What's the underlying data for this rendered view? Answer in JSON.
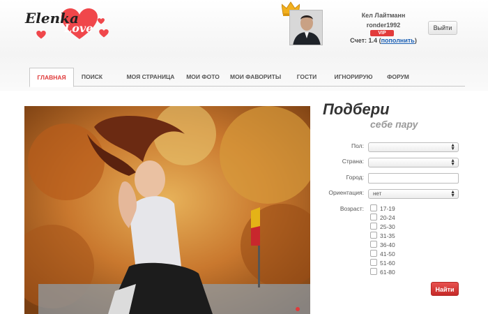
{
  "logo": {
    "line1": "Elenka",
    "line2": "Love"
  },
  "user": {
    "name": "Кел Лайтманн",
    "login": "ronder1992",
    "badge": "VIP",
    "account_label": "Счет: 1.4",
    "topup_link": "пополнить",
    "logout": "Выйти"
  },
  "nav": {
    "tabs": [
      {
        "label": "ГЛАВНАЯ",
        "active": true
      },
      {
        "label": "ПОИСК"
      },
      {
        "label": "МОЯ СТРАНИЦА"
      },
      {
        "label": "МОИ ФОТО"
      },
      {
        "label": "МОИ ФАВОРИТЫ"
      },
      {
        "label": "ГОСТИ"
      },
      {
        "label": "ИГНОРИРУЮ"
      },
      {
        "label": "ФОРУМ"
      }
    ]
  },
  "search": {
    "title": "Подбери",
    "subtitle": "себе пару",
    "gender_label": "Пол:",
    "gender_value": "",
    "country_label": "Страна:",
    "country_value": "",
    "city_label": "Город:",
    "city_value": "",
    "orientation_label": "Ориентация:",
    "orientation_value": "нет",
    "age_label": "Возраст:",
    "ages": [
      "17-19",
      "20-24",
      "25-30",
      "31-35",
      "36-40",
      "41-50",
      "51-60",
      "61-80"
    ],
    "submit": "Найти"
  },
  "colors": {
    "accent": "#e03a3a",
    "link": "#1a5fb4",
    "button": "#d33a37"
  }
}
